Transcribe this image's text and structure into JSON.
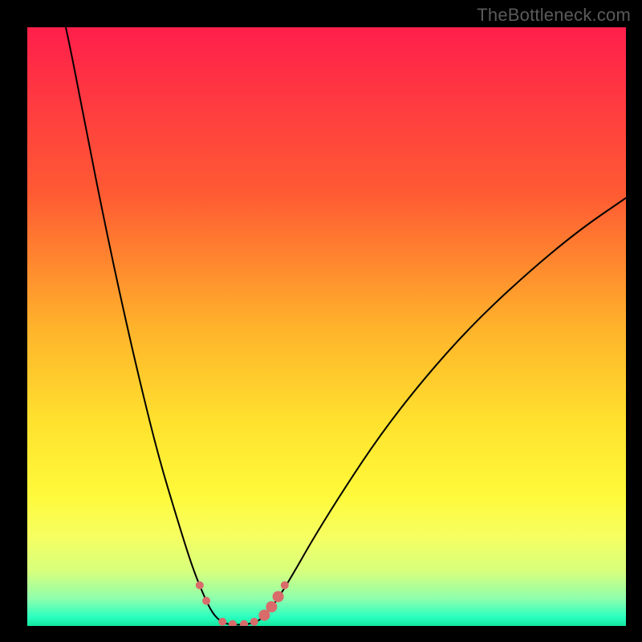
{
  "watermark": "TheBottleneck.com",
  "chart_data": {
    "type": "line",
    "title": "",
    "xlabel": "",
    "ylabel": "",
    "xlim": [
      0,
      100
    ],
    "ylim": [
      0,
      100
    ],
    "grid": false,
    "legend": false,
    "gradient": {
      "stops": [
        {
          "offset": 0.0,
          "color": "#ff1f4b"
        },
        {
          "offset": 0.28,
          "color": "#ff5b33"
        },
        {
          "offset": 0.5,
          "color": "#ffb22b"
        },
        {
          "offset": 0.66,
          "color": "#ffe22e"
        },
        {
          "offset": 0.78,
          "color": "#fff93a"
        },
        {
          "offset": 0.85,
          "color": "#f6ff60"
        },
        {
          "offset": 0.91,
          "color": "#d6ff7e"
        },
        {
          "offset": 0.955,
          "color": "#8dffad"
        },
        {
          "offset": 0.985,
          "color": "#2bffc0"
        },
        {
          "offset": 1.0,
          "color": "#12e89e"
        }
      ]
    },
    "series": [
      {
        "name": "bottleneck-curve",
        "style": {
          "stroke": "#000000",
          "width": 2
        },
        "points": [
          {
            "x": 6.0,
            "y": 102.0
          },
          {
            "x": 7.5,
            "y": 95.0
          },
          {
            "x": 10.0,
            "y": 82.0
          },
          {
            "x": 13.0,
            "y": 67.0
          },
          {
            "x": 16.0,
            "y": 53.0
          },
          {
            "x": 19.0,
            "y": 40.0
          },
          {
            "x": 22.0,
            "y": 28.0
          },
          {
            "x": 25.0,
            "y": 18.0
          },
          {
            "x": 27.5,
            "y": 10.0
          },
          {
            "x": 29.5,
            "y": 5.0
          },
          {
            "x": 31.0,
            "y": 2.0
          },
          {
            "x": 32.5,
            "y": 0.6
          },
          {
            "x": 34.0,
            "y": 0.2
          },
          {
            "x": 36.0,
            "y": 0.2
          },
          {
            "x": 38.0,
            "y": 0.5
          },
          {
            "x": 39.5,
            "y": 1.5
          },
          {
            "x": 41.5,
            "y": 4.0
          },
          {
            "x": 44.0,
            "y": 8.0
          },
          {
            "x": 48.0,
            "y": 15.0
          },
          {
            "x": 53.0,
            "y": 23.0
          },
          {
            "x": 59.0,
            "y": 32.0
          },
          {
            "x": 66.0,
            "y": 41.0
          },
          {
            "x": 74.0,
            "y": 50.0
          },
          {
            "x": 83.0,
            "y": 58.5
          },
          {
            "x": 92.0,
            "y": 66.0
          },
          {
            "x": 100.0,
            "y": 71.5
          }
        ]
      },
      {
        "name": "threshold-markers",
        "style": {
          "fill": "#d96b6b",
          "radiusSmall": 5,
          "radiusLarge": 7
        },
        "points": [
          {
            "x": 28.8,
            "y": 6.8,
            "r": "small"
          },
          {
            "x": 29.9,
            "y": 4.2,
            "r": "small"
          },
          {
            "x": 32.6,
            "y": 0.7,
            "r": "small"
          },
          {
            "x": 34.3,
            "y": 0.3,
            "r": "small"
          },
          {
            "x": 36.2,
            "y": 0.3,
            "r": "small"
          },
          {
            "x": 37.9,
            "y": 0.7,
            "r": "small"
          },
          {
            "x": 39.6,
            "y": 1.8,
            "r": "large"
          },
          {
            "x": 40.8,
            "y": 3.2,
            "r": "large"
          },
          {
            "x": 41.9,
            "y": 4.9,
            "r": "large"
          },
          {
            "x": 43.0,
            "y": 6.8,
            "r": "small"
          }
        ]
      }
    ]
  }
}
